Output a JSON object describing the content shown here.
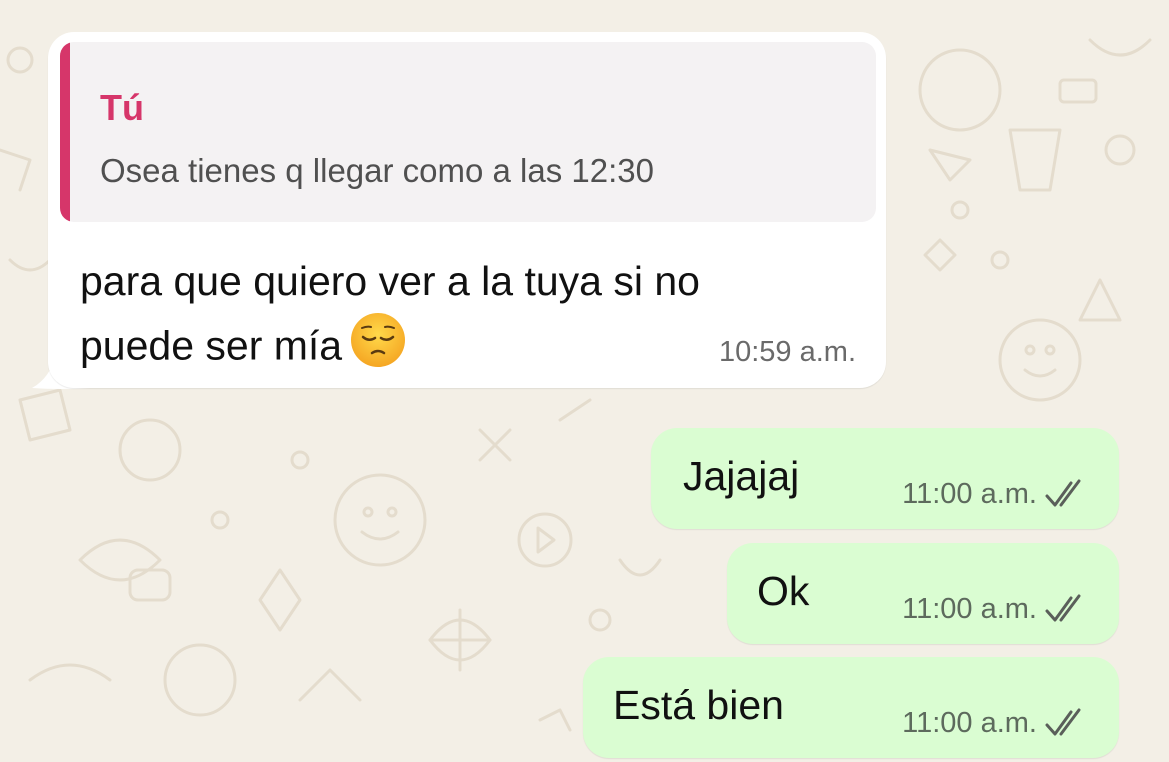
{
  "incoming": {
    "quote": {
      "author": "Tú",
      "text": "Osea tienes q llegar como a las 12:30"
    },
    "text_line1": "para que quiero ver a la tuya si no",
    "text_line2": "puede ser mía",
    "emoji": "pensive-face",
    "time": "10:59 a.m."
  },
  "outgoing": [
    {
      "text": "Jajajaj",
      "time": "11:00 a.m.",
      "status": "read"
    },
    {
      "text": "Ok",
      "time": "11:00 a.m.",
      "status": "read"
    },
    {
      "text": "Está bien",
      "time": "11:00 a.m.",
      "status": "read"
    }
  ],
  "colors": {
    "background": "#f3efe6",
    "incoming_bubble": "#ffffff",
    "outgoing_bubble": "#dafdd2",
    "quote_accent": "#d6366a"
  }
}
